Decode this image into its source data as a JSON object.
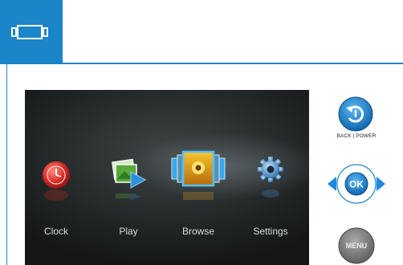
{
  "header": {
    "tab_icon": "frame-device-icon",
    "accent_color": "#1a85c8"
  },
  "screen": {
    "menu_items": [
      {
        "label": "Clock",
        "icon": "clock-icon"
      },
      {
        "label": "Play",
        "icon": "play-slideshow-icon"
      },
      {
        "label": "Browse",
        "icon": "browse-photos-icon"
      },
      {
        "label": "Settings",
        "icon": "gear-icon"
      }
    ],
    "selected_index": 2
  },
  "controls": {
    "back_power_label": "BACK | POWER",
    "ok_label": "OK",
    "menu_label": "MENU"
  }
}
